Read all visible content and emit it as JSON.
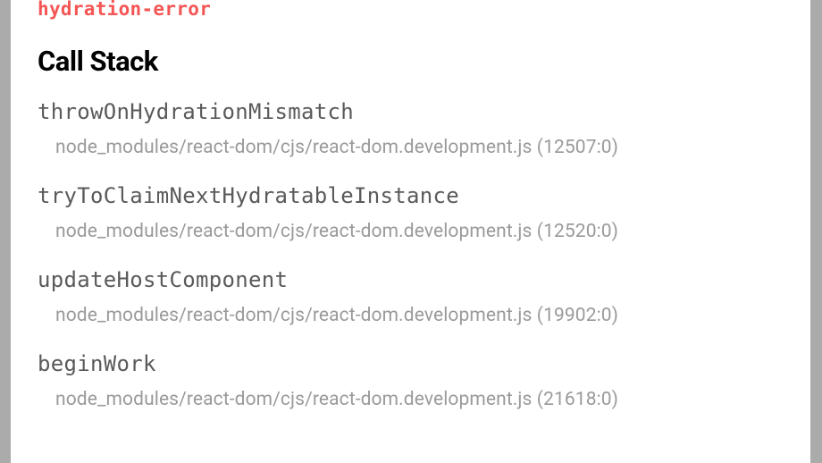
{
  "error_link": "hydration-error",
  "section_title": "Call Stack",
  "frames": [
    {
      "fn": "throwOnHydrationMismatch",
      "src": "node_modules/react-dom/cjs/react-dom.development.js (12507:0)"
    },
    {
      "fn": "tryToClaimNextHydratableInstance",
      "src": "node_modules/react-dom/cjs/react-dom.development.js (12520:0)"
    },
    {
      "fn": "updateHostComponent",
      "src": "node_modules/react-dom/cjs/react-dom.development.js (19902:0)"
    },
    {
      "fn": "beginWork",
      "src": "node_modules/react-dom/cjs/react-dom.development.js (21618:0)"
    }
  ]
}
